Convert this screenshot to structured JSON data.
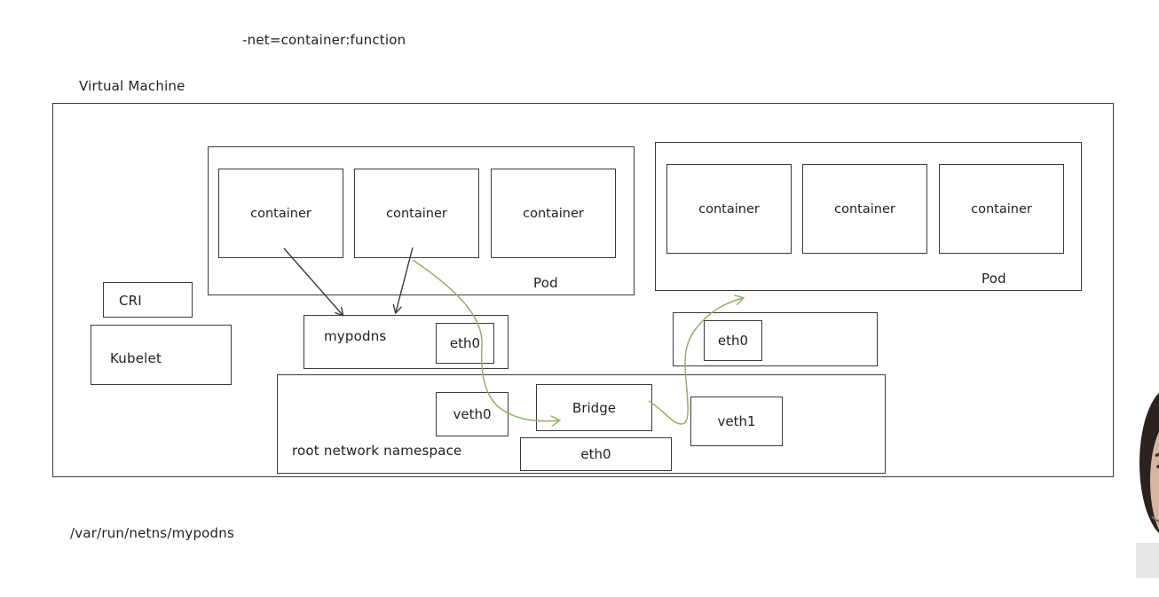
{
  "top_note": "-net=container:function",
  "bottom_note": "/var/run/netns/mypodns",
  "vm_label": "Virtual Machine",
  "pod_left": {
    "label": "Pod",
    "containers": [
      "container",
      "container",
      "container"
    ]
  },
  "pod_right": {
    "label": "Pod",
    "containers": [
      "container",
      "container",
      "container"
    ]
  },
  "cri_label": "CRI",
  "kubelet_label": "Kubelet",
  "mypodns": {
    "label": "mypodns",
    "eth0": "eth0"
  },
  "right_ns": {
    "eth0": "eth0"
  },
  "root_ns": {
    "label": "root network namespace",
    "veth0": "veth0",
    "bridge": "Bridge",
    "veth1": "veth1",
    "eth0": "eth0"
  },
  "colors": {
    "line": "#3a3a3a",
    "green_path": "#8fb06a"
  }
}
